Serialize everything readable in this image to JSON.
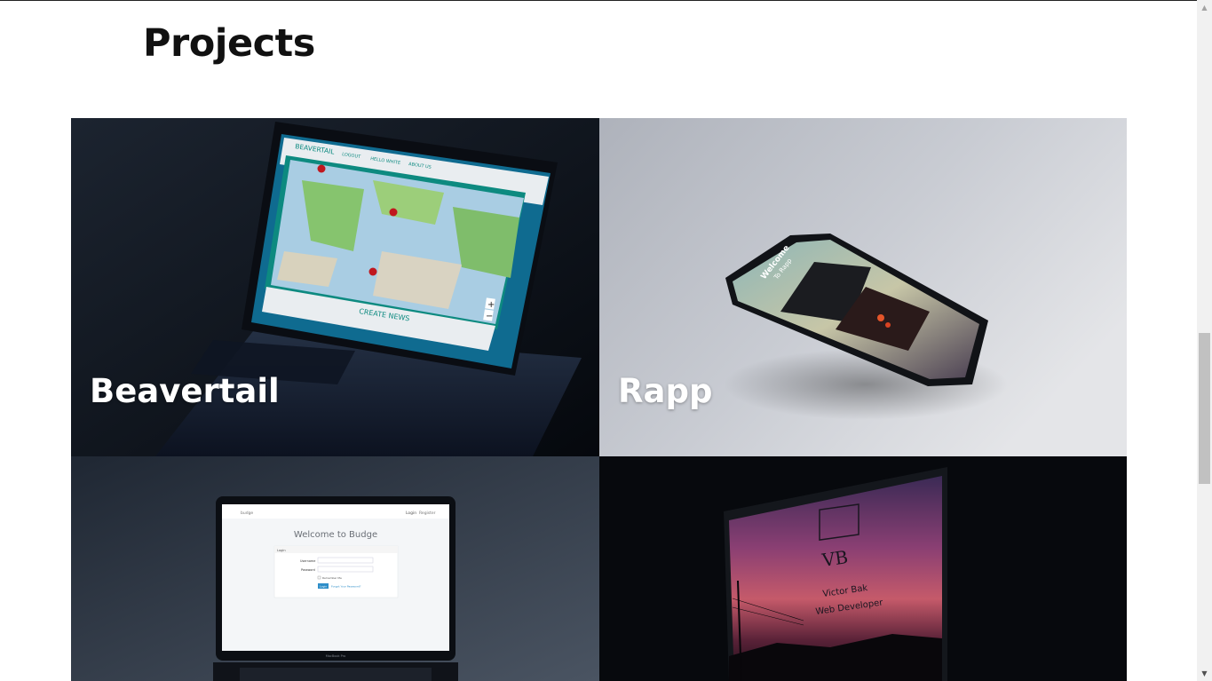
{
  "page": {
    "title": "Projects"
  },
  "projects": [
    {
      "title": "Beavertail",
      "screen": {
        "brand": "BEAVERTAIL",
        "nav": [
          "LOGOUT",
          "HELLO WHITE",
          "ABOUT US"
        ],
        "footer_link": "CREATE NEWS",
        "zoom_in": "+",
        "zoom_out": "−"
      }
    },
    {
      "title": "Rapp",
      "screen": {
        "heading": "Welcome",
        "subheading": "To Rapp"
      }
    },
    {
      "title": "",
      "screen": {
        "brand": "budge",
        "nav_login": "Login",
        "nav_register": "Register",
        "heading": "Welcome to Budge",
        "panel_title": "Login",
        "username_label": "Username",
        "password_label": "Password",
        "remember_label": "Remember Me",
        "login_button": "Login",
        "forgot_link": "Forgot Your Password?",
        "laptop_label": "MacBook Pro"
      }
    },
    {
      "title": "",
      "screen": {
        "monogram": "VB",
        "name": "Victor Bak",
        "role": "Web Developer"
      }
    }
  ],
  "colors": {
    "map_frame": "#0d8a80",
    "accent_link": "#2f8fc9"
  },
  "icons": {
    "scroll_up": "triangle-up-icon",
    "scroll_down": "triangle-down-icon",
    "map_pin": "map-pin-icon"
  }
}
